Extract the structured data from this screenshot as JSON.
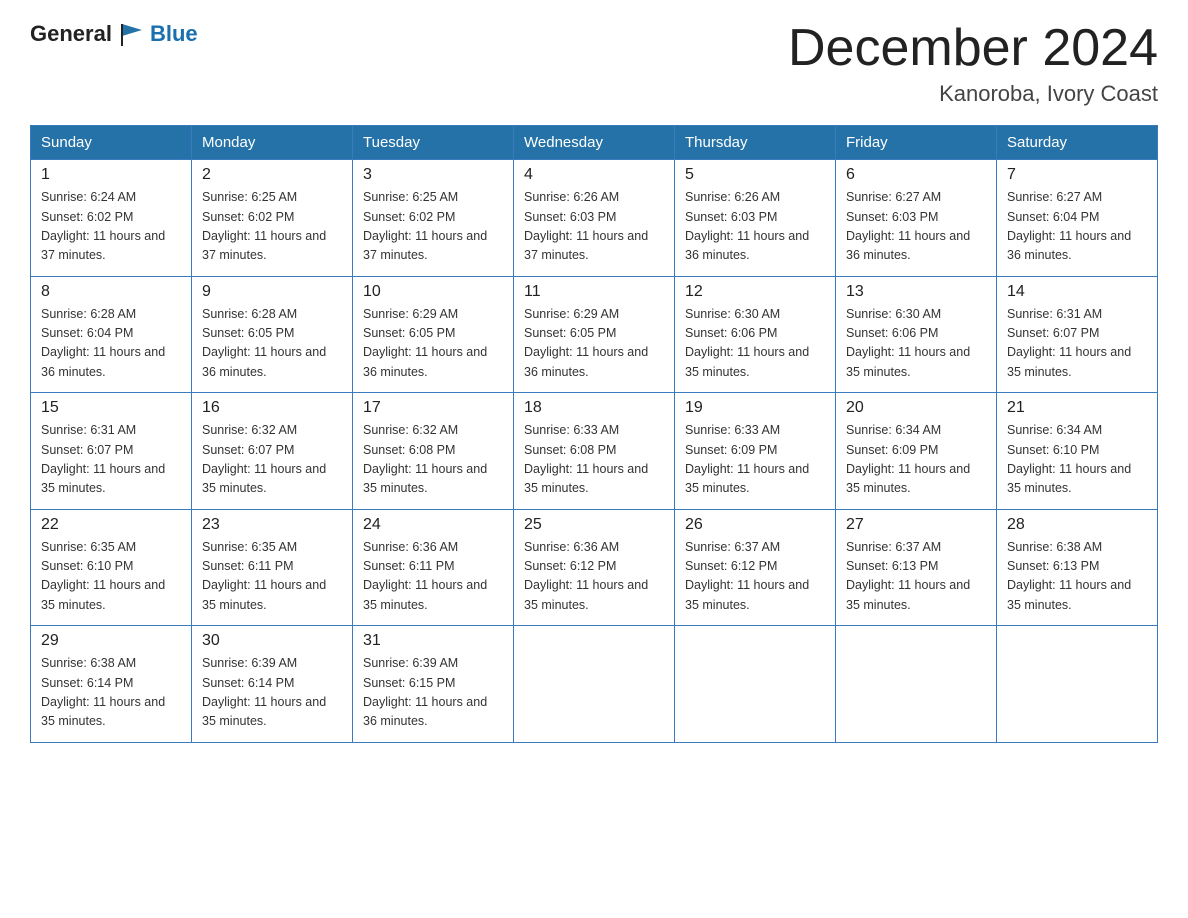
{
  "header": {
    "logo_general": "General",
    "logo_blue": "Blue",
    "month_title": "December 2024",
    "location": "Kanoroba, Ivory Coast"
  },
  "weekdays": [
    "Sunday",
    "Monday",
    "Tuesday",
    "Wednesday",
    "Thursday",
    "Friday",
    "Saturday"
  ],
  "weeks": [
    [
      {
        "day": "1",
        "sunrise": "6:24 AM",
        "sunset": "6:02 PM",
        "daylight": "11 hours and 37 minutes."
      },
      {
        "day": "2",
        "sunrise": "6:25 AM",
        "sunset": "6:02 PM",
        "daylight": "11 hours and 37 minutes."
      },
      {
        "day": "3",
        "sunrise": "6:25 AM",
        "sunset": "6:02 PM",
        "daylight": "11 hours and 37 minutes."
      },
      {
        "day": "4",
        "sunrise": "6:26 AM",
        "sunset": "6:03 PM",
        "daylight": "11 hours and 37 minutes."
      },
      {
        "day": "5",
        "sunrise": "6:26 AM",
        "sunset": "6:03 PM",
        "daylight": "11 hours and 36 minutes."
      },
      {
        "day": "6",
        "sunrise": "6:27 AM",
        "sunset": "6:03 PM",
        "daylight": "11 hours and 36 minutes."
      },
      {
        "day": "7",
        "sunrise": "6:27 AM",
        "sunset": "6:04 PM",
        "daylight": "11 hours and 36 minutes."
      }
    ],
    [
      {
        "day": "8",
        "sunrise": "6:28 AM",
        "sunset": "6:04 PM",
        "daylight": "11 hours and 36 minutes."
      },
      {
        "day": "9",
        "sunrise": "6:28 AM",
        "sunset": "6:05 PM",
        "daylight": "11 hours and 36 minutes."
      },
      {
        "day": "10",
        "sunrise": "6:29 AM",
        "sunset": "6:05 PM",
        "daylight": "11 hours and 36 minutes."
      },
      {
        "day": "11",
        "sunrise": "6:29 AM",
        "sunset": "6:05 PM",
        "daylight": "11 hours and 36 minutes."
      },
      {
        "day": "12",
        "sunrise": "6:30 AM",
        "sunset": "6:06 PM",
        "daylight": "11 hours and 35 minutes."
      },
      {
        "day": "13",
        "sunrise": "6:30 AM",
        "sunset": "6:06 PM",
        "daylight": "11 hours and 35 minutes."
      },
      {
        "day": "14",
        "sunrise": "6:31 AM",
        "sunset": "6:07 PM",
        "daylight": "11 hours and 35 minutes."
      }
    ],
    [
      {
        "day": "15",
        "sunrise": "6:31 AM",
        "sunset": "6:07 PM",
        "daylight": "11 hours and 35 minutes."
      },
      {
        "day": "16",
        "sunrise": "6:32 AM",
        "sunset": "6:07 PM",
        "daylight": "11 hours and 35 minutes."
      },
      {
        "day": "17",
        "sunrise": "6:32 AM",
        "sunset": "6:08 PM",
        "daylight": "11 hours and 35 minutes."
      },
      {
        "day": "18",
        "sunrise": "6:33 AM",
        "sunset": "6:08 PM",
        "daylight": "11 hours and 35 minutes."
      },
      {
        "day": "19",
        "sunrise": "6:33 AM",
        "sunset": "6:09 PM",
        "daylight": "11 hours and 35 minutes."
      },
      {
        "day": "20",
        "sunrise": "6:34 AM",
        "sunset": "6:09 PM",
        "daylight": "11 hours and 35 minutes."
      },
      {
        "day": "21",
        "sunrise": "6:34 AM",
        "sunset": "6:10 PM",
        "daylight": "11 hours and 35 minutes."
      }
    ],
    [
      {
        "day": "22",
        "sunrise": "6:35 AM",
        "sunset": "6:10 PM",
        "daylight": "11 hours and 35 minutes."
      },
      {
        "day": "23",
        "sunrise": "6:35 AM",
        "sunset": "6:11 PM",
        "daylight": "11 hours and 35 minutes."
      },
      {
        "day": "24",
        "sunrise": "6:36 AM",
        "sunset": "6:11 PM",
        "daylight": "11 hours and 35 minutes."
      },
      {
        "day": "25",
        "sunrise": "6:36 AM",
        "sunset": "6:12 PM",
        "daylight": "11 hours and 35 minutes."
      },
      {
        "day": "26",
        "sunrise": "6:37 AM",
        "sunset": "6:12 PM",
        "daylight": "11 hours and 35 minutes."
      },
      {
        "day": "27",
        "sunrise": "6:37 AM",
        "sunset": "6:13 PM",
        "daylight": "11 hours and 35 minutes."
      },
      {
        "day": "28",
        "sunrise": "6:38 AM",
        "sunset": "6:13 PM",
        "daylight": "11 hours and 35 minutes."
      }
    ],
    [
      {
        "day": "29",
        "sunrise": "6:38 AM",
        "sunset": "6:14 PM",
        "daylight": "11 hours and 35 minutes."
      },
      {
        "day": "30",
        "sunrise": "6:39 AM",
        "sunset": "6:14 PM",
        "daylight": "11 hours and 35 minutes."
      },
      {
        "day": "31",
        "sunrise": "6:39 AM",
        "sunset": "6:15 PM",
        "daylight": "11 hours and 36 minutes."
      },
      null,
      null,
      null,
      null
    ]
  ]
}
